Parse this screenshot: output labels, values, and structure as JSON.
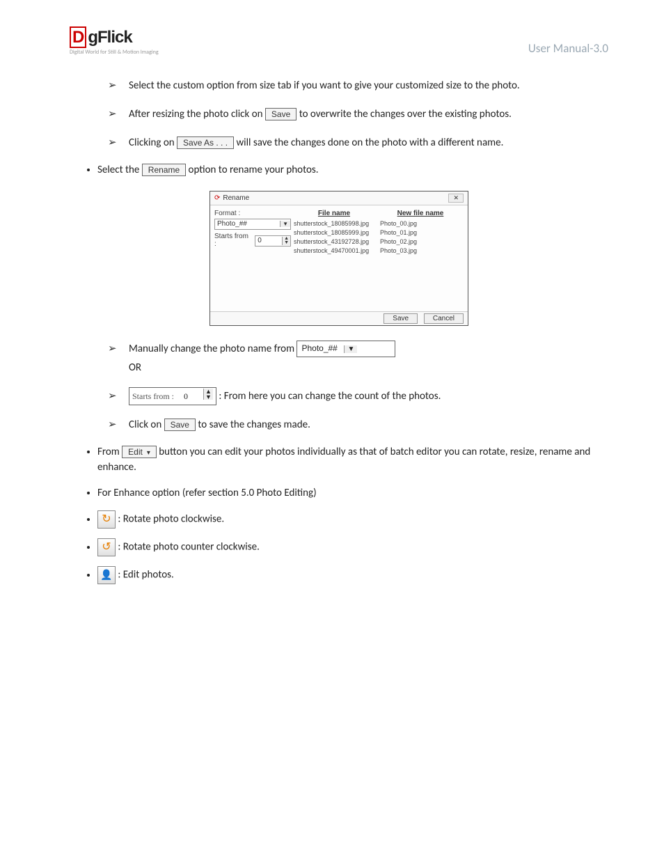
{
  "header": {
    "logo_main": "gFlick",
    "logo_d": "D",
    "logo_tagline": "Digital World for Still & Motion Imaging",
    "manual": "User Manual-3.0"
  },
  "bullets": {
    "b1": "Select the custom option from size tab if you want to give your customized size to the photo.",
    "b2a": "After resizing the photo click on ",
    "b2b": " to overwrite the changes over the existing photos.",
    "b3a": "Clicking on ",
    "b3b": " will save the changes done on the photo with a different name.",
    "sel_rename_a": "Select the ",
    "sel_rename_b": " option to rename your photos.",
    "man_a": "Manually change the photo name from ",
    "man_or": "OR",
    "sf_after": ": From here you can change the count of the photos.",
    "save_a": "Click on ",
    "save_b": " to save the changes made.",
    "from_a": "From ",
    "from_b": " button you can edit your photos individually as that of batch editor you can rotate, resize, rename and enhance.",
    "enhance": "For Enhance option (refer section 5.0 Photo Editing)",
    "rot_cw": ": Rotate photo clockwise.",
    "rot_ccw": ": Rotate photo counter clockwise.",
    "edit_ph": ": Edit photos."
  },
  "buttons": {
    "save": "Save",
    "save_as": "Save As . . .",
    "rename": "Rename",
    "photo_hash": "Photo_##",
    "starts_from_lbl": "Starts from :",
    "starts_from_val": "0",
    "edit": "Edit"
  },
  "dialog": {
    "title": "Rename",
    "format_lbl": "Format :",
    "format_val": "Photo_##",
    "starts_lbl": "Starts from :",
    "starts_val": "0",
    "col1": "File name",
    "col2": "New file name",
    "files": [
      "shutterstock_18085998.jpg",
      "shutterstock_18085999.jpg",
      "shutterstock_43192728.jpg",
      "shutterstock_49470001.jpg"
    ],
    "newfiles": [
      "Photo_00.jpg",
      "Photo_01.jpg",
      "Photo_02.jpg",
      "Photo_03.jpg"
    ],
    "save": "Save",
    "cancel": "Cancel",
    "close": "✕"
  }
}
